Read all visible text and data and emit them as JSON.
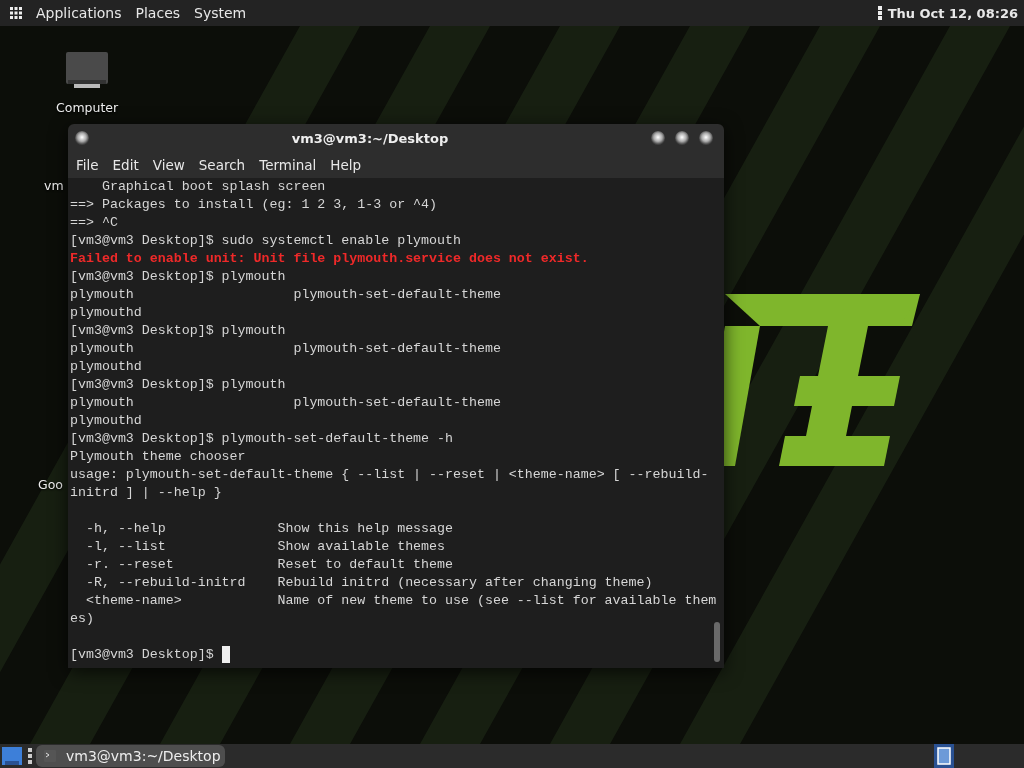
{
  "top_bar": {
    "menus": [
      "Applications",
      "Places",
      "System"
    ],
    "clock": "Thu Oct 12, 08:26"
  },
  "desktop": {
    "icons": [
      {
        "label": "Computer",
        "kind": "computer"
      },
      {
        "label": "vm",
        "kind": "label"
      },
      {
        "label": "Goo",
        "kind": "label"
      }
    ]
  },
  "terminal": {
    "title": "vm3@vm3:~/Desktop",
    "menu": [
      "File",
      "Edit",
      "View",
      "Search",
      "Terminal",
      "Help"
    ],
    "lines": [
      {
        "text": "    Graphical boot splash screen",
        "kind": "normal"
      },
      {
        "text": "==> Packages to install (eg: 1 2 3, 1-3 or ^4)",
        "kind": "normal"
      },
      {
        "text": "==> ^C",
        "kind": "normal"
      },
      {
        "text": "[vm3@vm3 Desktop]$ sudo systemctl enable plymouth",
        "kind": "normal"
      },
      {
        "text": "Failed to enable unit: Unit file plymouth.service does not exist.",
        "kind": "error"
      },
      {
        "text": "[vm3@vm3 Desktop]$ plymouth",
        "kind": "normal"
      },
      {
        "text": "plymouth                    plymouth-set-default-theme",
        "kind": "normal"
      },
      {
        "text": "plymouthd",
        "kind": "normal"
      },
      {
        "text": "[vm3@vm3 Desktop]$ plymouth",
        "kind": "normal"
      },
      {
        "text": "plymouth                    plymouth-set-default-theme",
        "kind": "normal"
      },
      {
        "text": "plymouthd",
        "kind": "normal"
      },
      {
        "text": "[vm3@vm3 Desktop]$ plymouth",
        "kind": "normal"
      },
      {
        "text": "plymouth                    plymouth-set-default-theme",
        "kind": "normal"
      },
      {
        "text": "plymouthd",
        "kind": "normal"
      },
      {
        "text": "[vm3@vm3 Desktop]$ plymouth-set-default-theme -h",
        "kind": "normal"
      },
      {
        "text": "Plymouth theme chooser",
        "kind": "normal"
      },
      {
        "text": "usage: plymouth-set-default-theme { --list | --reset | <theme-name> [ --rebuild-",
        "kind": "normal"
      },
      {
        "text": "initrd ] | --help }",
        "kind": "normal"
      },
      {
        "kind": "blank"
      },
      {
        "text": "  -h, --help              Show this help message",
        "kind": "normal"
      },
      {
        "text": "  -l, --list              Show available themes",
        "kind": "normal"
      },
      {
        "text": "  -r. --reset             Reset to default theme",
        "kind": "normal"
      },
      {
        "text": "  -R, --rebuild-initrd    Rebuild initrd (necessary after changing theme)",
        "kind": "normal"
      },
      {
        "text": "  <theme-name>            Name of new theme to use (see --list for available them",
        "kind": "normal"
      },
      {
        "text": "es)",
        "kind": "normal"
      },
      {
        "kind": "blank"
      },
      {
        "text": "[vm3@vm3 Desktop]$ ",
        "kind": "prompt"
      }
    ]
  },
  "taskbar": {
    "tasks": [
      {
        "label": "vm3@vm3:~/Desktop",
        "selected": true
      }
    ],
    "workspaces": [
      {
        "selected": true
      }
    ]
  }
}
